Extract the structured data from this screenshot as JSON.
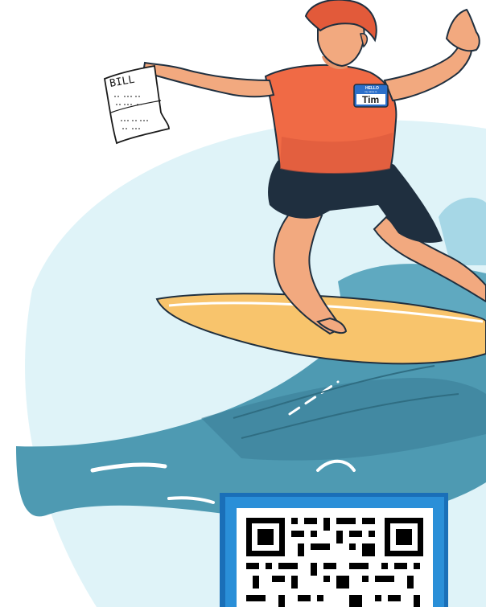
{
  "bill": {
    "label": "BILL"
  },
  "name_tag": {
    "header": "HELLO",
    "subheader": "my name is",
    "name": "Tim"
  },
  "icons": [
    "bill-paper-icon",
    "qr-code-icon"
  ],
  "colors": {
    "sky": "#dff3f8",
    "wave": "#4e9ab2",
    "wave_dark": "#3a7f97",
    "wave_light": "#7cc6dc",
    "board": "#f8c46c",
    "shirt": "#f06a45",
    "shorts": "#1f2f3f",
    "skin": "#f2a97f",
    "hair": "#e25a3a",
    "tag_blue": "#2c6fc9",
    "qr_frame": "#2a8fd8"
  }
}
